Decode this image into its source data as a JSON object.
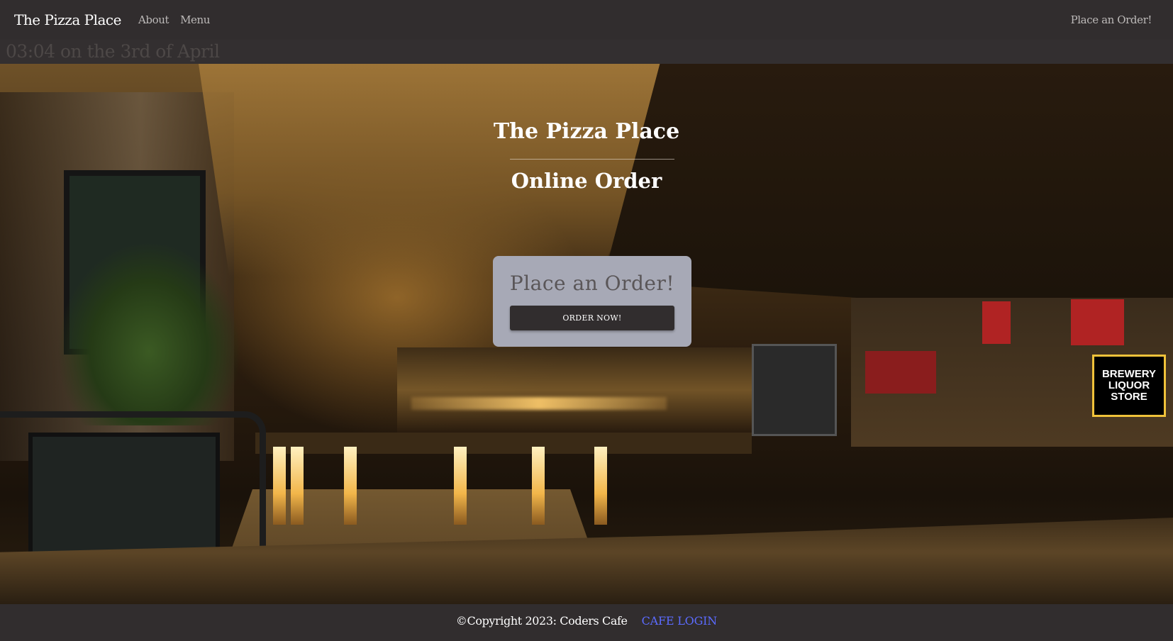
{
  "navbar": {
    "brand": "The Pizza Place",
    "links": [
      "About",
      "Menu"
    ],
    "right_link": "Place an Order!"
  },
  "timebar": {
    "text": "03:04 on the 3rd of April"
  },
  "hero": {
    "title": "The Pizza Place",
    "subtitle": "Online Order",
    "background_sign": "BREWERY LIQUOR STORE"
  },
  "order_card": {
    "title": "Place an Order!",
    "button_label": "ORDER NOW!"
  },
  "footer": {
    "copyright": "©Copyright 2023: Coders Cafe",
    "login_link": "CAFE LOGIN"
  },
  "colors": {
    "navbar_bg": "#312d2e",
    "card_bg": "#a7a9b6",
    "button_bg": "#312d2e",
    "link_accent": "#5b6bff"
  }
}
